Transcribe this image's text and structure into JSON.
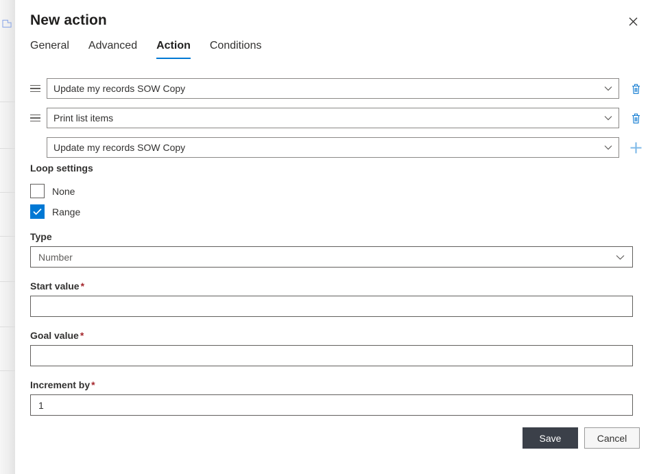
{
  "backdrop": {
    "icon": "flow-step-icon"
  },
  "dialog": {
    "title": "New action",
    "close_icon": "close-icon"
  },
  "tabs": [
    {
      "label": "General",
      "active": false
    },
    {
      "label": "Advanced",
      "active": false
    },
    {
      "label": "Action",
      "active": true
    },
    {
      "label": "Conditions",
      "active": false
    }
  ],
  "action_rows": [
    {
      "value": "Update my records SOW Copy",
      "has_drag_handle": true,
      "handle_icon": "drag-handle-icon",
      "chevron_icon": "chevron-down-icon",
      "trailing_icon": "delete-icon",
      "trailing_kind": "delete"
    },
    {
      "value": "Print list items",
      "has_drag_handle": true,
      "handle_icon": "drag-handle-icon",
      "chevron_icon": "chevron-down-icon",
      "trailing_icon": "delete-icon",
      "trailing_kind": "delete"
    },
    {
      "value": "Update my records SOW Copy",
      "has_drag_handle": false,
      "handle_icon": "",
      "chevron_icon": "chevron-down-icon",
      "trailing_icon": "add-icon",
      "trailing_kind": "add"
    }
  ],
  "loop_settings": {
    "heading": "Loop settings",
    "options": [
      {
        "label": "None",
        "checked": false
      },
      {
        "label": "Range",
        "checked": true
      }
    ],
    "check_icon": "checkmark-icon"
  },
  "fields": {
    "type": {
      "label": "Type",
      "required": false,
      "value": "Number",
      "chevron_icon": "chevron-down-icon"
    },
    "start_value": {
      "label": "Start value",
      "required": true,
      "required_marker": "*",
      "value": ""
    },
    "goal_value": {
      "label": "Goal value",
      "required": true,
      "required_marker": "*",
      "value": ""
    },
    "increment_by": {
      "label": "Increment by",
      "required": true,
      "required_marker": "*",
      "value": "1"
    }
  },
  "footer": {
    "save_label": "Save",
    "cancel_label": "Cancel"
  },
  "colors": {
    "accent": "#0078d4",
    "accent_muted": "#7eb9e8",
    "required": "#a4262c",
    "primary_button": "#3b4049",
    "text": "#323130"
  }
}
